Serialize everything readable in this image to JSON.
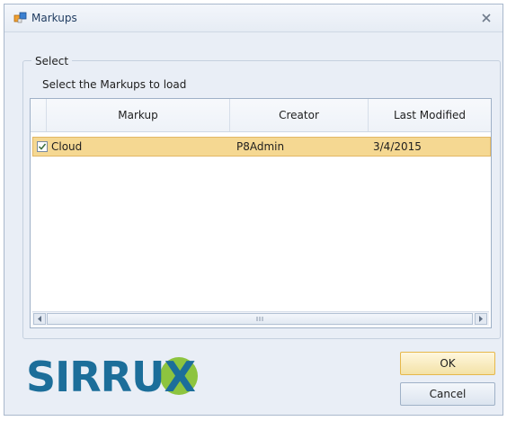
{
  "window": {
    "title": "Markups",
    "icon": "markups-app-icon",
    "close_icon": "close-icon"
  },
  "group": {
    "title": "Select",
    "instruction": "Select the Markups to load"
  },
  "grid": {
    "columns": [
      "Markup",
      "Creator",
      "Last Modified"
    ],
    "rows": [
      {
        "checked": true,
        "markup": "Cloud",
        "creator": "P8Admin",
        "last_modified": "3/4/2015"
      }
    ],
    "selected_row_color": "#f5d892",
    "scrollbar": {
      "left_icon": "scroll-left-icon",
      "right_icon": "scroll-right-icon"
    }
  },
  "logo": {
    "text": "SIRRUX",
    "accent_color": "#8dc43f",
    "brand_color": "#1c6e9a"
  },
  "buttons": {
    "ok": "OK",
    "cancel": "Cancel"
  }
}
